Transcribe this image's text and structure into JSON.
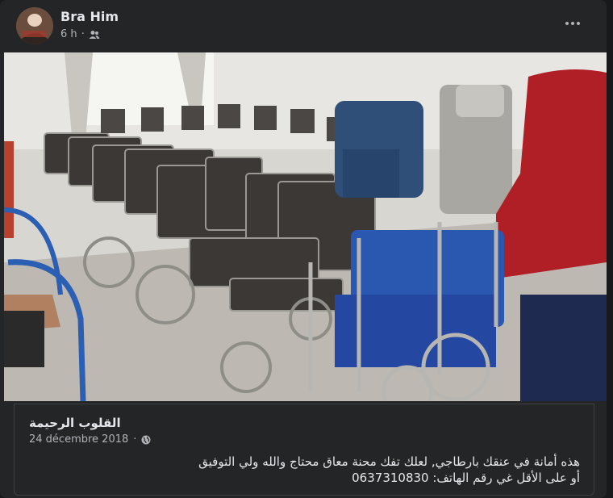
{
  "post": {
    "author": "Bra Him",
    "time": "6 h",
    "audience_icon": "friends-icon",
    "more_icon": "more-options-icon"
  },
  "photo": {
    "subject": "wheelchairs"
  },
  "link": {
    "title": "القلوب الرحيمة",
    "date": "24 décembre 2018",
    "separator": "·",
    "privacy_icon": "globe-icon",
    "lines": [
      "هذه أمانة في عنقك بارطاجي, لعلك تفك محنة معاق محتاج والله ولي التوفيق",
      "أو على الأقل غي رقم الهاتف: 0637310830"
    ]
  }
}
